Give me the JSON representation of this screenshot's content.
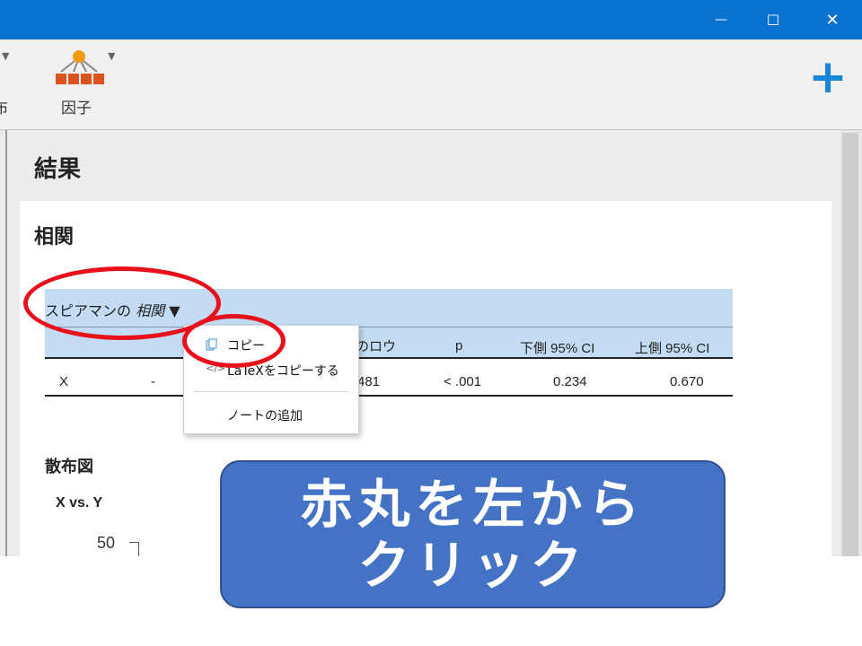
{
  "window": {
    "minimize_glyph": "—",
    "maximize_glyph": "☐",
    "close_glyph": "✕",
    "accent_color": "#0a72d0"
  },
  "toolbar": {
    "partial_label": "布",
    "factor_label": "因子",
    "add_glyph": "+"
  },
  "results": {
    "title": "結果",
    "correlation_title": "相関",
    "table": {
      "title_prefix": "スピアマンの",
      "title_italic": "相関",
      "title_arrow": "▼",
      "headers": [
        "のロウ",
        "p",
        "下側 95% CI",
        "上側 95% CI"
      ],
      "row": [
        "X",
        "-",
        "481",
        "< .001",
        "0.234",
        "0.670"
      ]
    },
    "scatter_title": "散布図",
    "scatter_subtitle": "X vs. Y",
    "y_tick": "50"
  },
  "context_menu": {
    "copy": "コピー",
    "copy_latex": "LaTeXをコピーする",
    "add_note": "ノートの追加"
  },
  "callout": {
    "line1": "赤丸を左から",
    "line2": "クリック"
  },
  "colors": {
    "highlight_ellipse": "#e8101a",
    "callout_fill": "#4472c4",
    "table_header": "#c3dcf3"
  }
}
